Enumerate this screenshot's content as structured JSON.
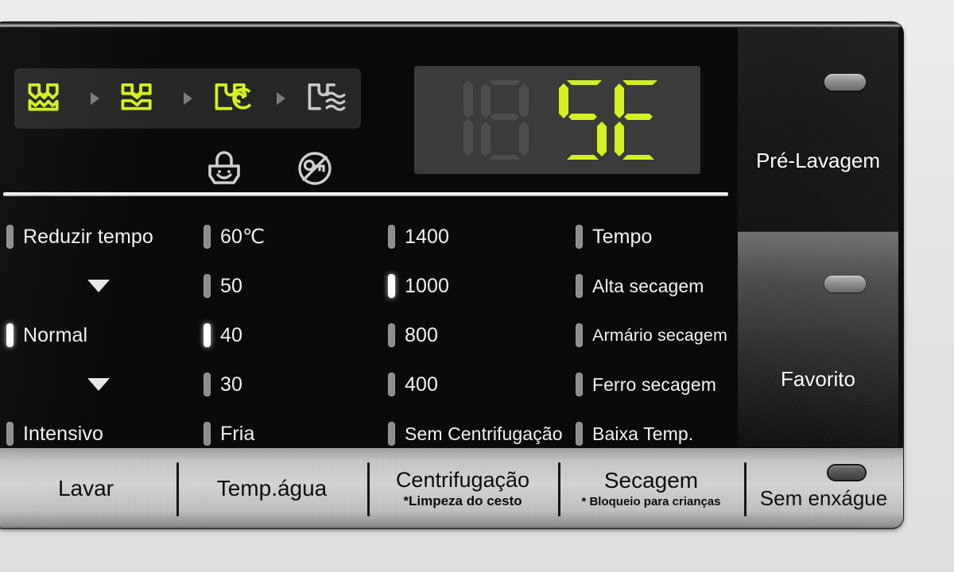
{
  "device": {
    "name": "washing-machine-control-panel",
    "accent_active": "#d4f023",
    "indicator_active": "#ffffff",
    "indicator_inactive": "#8d8d8d"
  },
  "phase_strip": {
    "name": "wash-cycle-progress",
    "steps": [
      {
        "icon": "wash-icon",
        "label": "Lavagem",
        "active": true
      },
      {
        "icon": "rinse-icon",
        "label": "Enxágue",
        "active": true
      },
      {
        "icon": "spin-icon",
        "label": "Centrifugação",
        "active": true
      },
      {
        "icon": "dry-icon",
        "label": "Secagem",
        "active": false
      }
    ],
    "separator": "arrow-right-icon"
  },
  "status_icons": [
    {
      "icon": "child-lock-icon",
      "label": "Bloqueio para crianças",
      "active": false
    },
    {
      "icon": "no-spin-icon",
      "label": "Sem centrifugação",
      "active": false
    }
  ],
  "display": {
    "name": "seven-segment-display",
    "value": "5E",
    "ghost_value": "18",
    "digits": [
      {
        "char": "1",
        "lit": false
      },
      {
        "char": "8",
        "lit": false
      },
      {
        "char": "5",
        "lit": true
      },
      {
        "char": "E",
        "lit": true
      }
    ],
    "lit_color": "#d4f023",
    "unlit_color": "#4d4d4d",
    "background": "#3b3b3b"
  },
  "options": {
    "columns": [
      {
        "name": "wash-level-column",
        "items": [
          {
            "label": "Reduzir tempo",
            "active": false,
            "type": "option"
          },
          {
            "label": "",
            "active": false,
            "type": "arrow"
          },
          {
            "label": "Normal",
            "active": true,
            "type": "option"
          },
          {
            "label": "",
            "active": false,
            "type": "arrow"
          },
          {
            "label": "Intensivo",
            "active": false,
            "type": "option"
          }
        ]
      },
      {
        "name": "water-temperature-column",
        "items": [
          {
            "label": "60℃",
            "active": false,
            "type": "option"
          },
          {
            "label": "50",
            "active": false,
            "type": "option"
          },
          {
            "label": "40",
            "active": true,
            "type": "option"
          },
          {
            "label": "30",
            "active": false,
            "type": "option"
          },
          {
            "label": "Fria",
            "active": false,
            "type": "option"
          }
        ]
      },
      {
        "name": "spin-speed-column",
        "items": [
          {
            "label": "1400",
            "active": false,
            "type": "option"
          },
          {
            "label": "1000",
            "active": true,
            "type": "option"
          },
          {
            "label": "800",
            "active": false,
            "type": "option"
          },
          {
            "label": "400",
            "active": false,
            "type": "option"
          },
          {
            "label": "Sem Centrifugação",
            "active": false,
            "type": "option"
          }
        ]
      },
      {
        "name": "drying-column",
        "items": [
          {
            "label": "Tempo",
            "active": false,
            "type": "option"
          },
          {
            "label": "Alta secagem",
            "active": false,
            "type": "option"
          },
          {
            "label": "Armário secagem",
            "active": false,
            "type": "option"
          },
          {
            "label": "Ferro secagem",
            "active": false,
            "type": "option"
          },
          {
            "label": "Baixa Temp.",
            "active": false,
            "type": "option"
          }
        ]
      }
    ]
  },
  "side_buttons": [
    {
      "name": "pre-wash-button",
      "label": "Pré-Lavagem",
      "led": "led-indicator",
      "led_on": false
    },
    {
      "name": "favorite-button",
      "label": "Favorito",
      "led": "led-indicator",
      "led_on": false
    }
  ],
  "bottom_buttons": [
    {
      "name": "lavar-button",
      "label": "Lavar",
      "sub": ""
    },
    {
      "name": "temp-agua-button",
      "label": "Temp.água",
      "sub": ""
    },
    {
      "name": "centrifugacao-button",
      "label": "Centrifugação",
      "sub": "*Limpeza do cesto"
    },
    {
      "name": "secagem-button",
      "label": "Secagem",
      "sub": "* Bloqueio para crianças"
    },
    {
      "name": "sem-enxague-button",
      "label": "Sem enxágue",
      "sub": "",
      "led": "led-indicator",
      "led_on": false
    }
  ]
}
